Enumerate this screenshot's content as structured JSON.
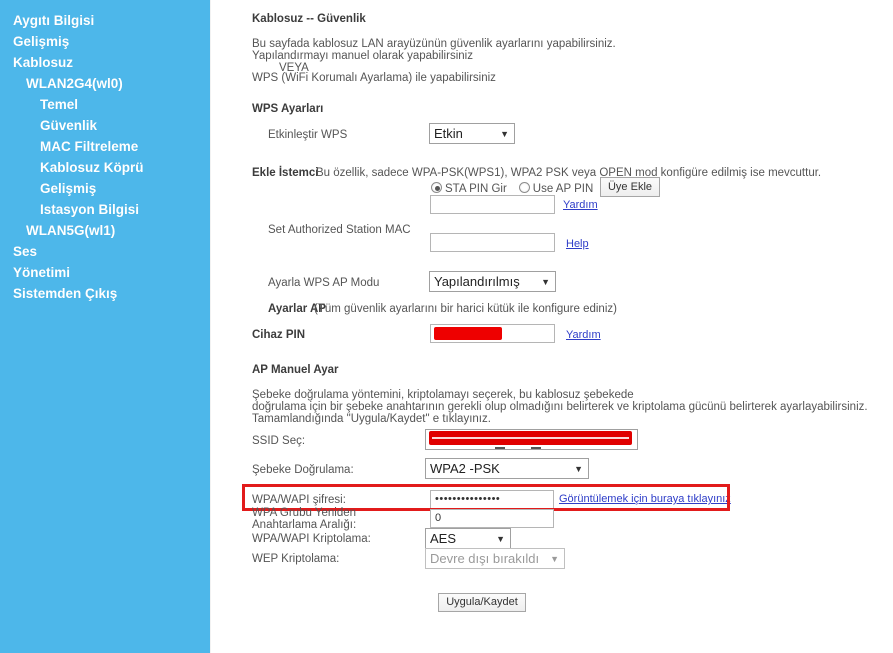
{
  "sidebar": {
    "bg_color": "#4db7ea",
    "items": [
      {
        "label": "Aygıtı Bilgisi",
        "level": 0
      },
      {
        "label": "Gelişmiş",
        "level": 0
      },
      {
        "label": "Kablosuz",
        "level": 0
      },
      {
        "label": "WLAN2G4(wl0)",
        "level": 1
      },
      {
        "label": "Temel",
        "level": 2
      },
      {
        "label": "Güvenlik",
        "level": 2
      },
      {
        "label": "MAC Filtreleme",
        "level": 2
      },
      {
        "label": "Kablosuz Köprü",
        "level": 2
      },
      {
        "label": "Gelişmiş",
        "level": 2
      },
      {
        "label": "Istasyon Bilgisi",
        "level": 2
      },
      {
        "label": "WLAN5G(wl1)",
        "level": 1
      },
      {
        "label": "Ses",
        "level": 0
      },
      {
        "label": "Yönetimi",
        "level": 0
      },
      {
        "label": "Sistemden Çıkış",
        "level": 0
      }
    ]
  },
  "page": {
    "title": "Kablosuz -- Güvenlik",
    "intro_line1": "Bu sayfada kablosuz LAN arayüzünün güvenlik ayarlarını yapabilirsiniz.",
    "intro_line2": "Yapılandırmayı manuel olarak yapabilirsiniz",
    "intro_or": "VEYA",
    "intro_line3": "WPS (WiFi Korumalı Ayarlama) ile yapabilirsiniz"
  },
  "wps": {
    "section_title": "WPS Ayarları",
    "enable_label": "Etkinleştir WPS",
    "enable_value": "Etkin",
    "add_client_label_bold": "Ekle İstemci",
    "add_client_note": "Bu özellik, sadece WPA-PSK(WPS1), WPA2 PSK veya OPEN mod konfigüre edilmiş ise mevcuttur.",
    "radio_sta_label": "STA PIN Gir",
    "radio_ap_label": "Use AP PIN",
    "radio_selected": "sta",
    "add_member_button": "Üye Ekle",
    "pin_input_value": "",
    "help_link_1": "Yardım",
    "authorized_mac_label": "Set Authorized Station MAC",
    "authorized_mac_value": "",
    "help_link_2": "Help",
    "ap_mode_label": "Ayarla WPS AP Modu",
    "ap_mode_value": "Yapılandırılmış",
    "ap_settings_note_bold": "Ayarlar AP",
    "ap_settings_note": "(Tüm güvenlik ayarlarını bir harici kütük ile konfigure ediniz)",
    "device_pin_label": "Cihaz PIN",
    "device_pin_value": "",
    "device_pin_redacted": true,
    "help_link_3": "Yardım"
  },
  "ap_manual": {
    "section_title": "AP Manuel Ayar",
    "desc_line1": "Şebeke doğrulama yöntemini, kriptolamayı seçerek, bu kablosuz şebekede",
    "desc_line2": "doğrulama için bir şebeke anahtarının gerekli olup olmadığını belirterek ve kriptolama gücünü belirterek ayarlayabilirsiniz.",
    "desc_line3": "Tamamlandığında \"Uygula/Kaydet\" e tıklayınız.",
    "ssid_label": "SSID Seç:",
    "ssid_value": "",
    "ssid_redacted": true,
    "network_auth_label": "Şebeke Doğrulama:",
    "network_auth_value": "WPA2 -PSK",
    "wpa_key_label": "WPA/WAPI şifresi:",
    "wpa_key_value": "•••••••••••••••",
    "wpa_key_reveal_link": "Görüntülemek için buraya tıklayınız",
    "wpa_key_highlighted": true,
    "rekey_label": "WPA Grubu Yeniden Anahtarlama Aralığı:",
    "rekey_value": "0",
    "wpa_crypto_label": "WPA/WAPI Kriptolama:",
    "wpa_crypto_value": "AES",
    "wep_crypto_label": "WEP Kriptolama:",
    "wep_crypto_value": "Devre dışı bırakıldı",
    "wep_crypto_disabled": true,
    "submit_button": "Uygula/Kaydet"
  },
  "colors": {
    "sidebar": "#4db7ea",
    "link": "#2e3dc8",
    "redaction": "#ee0000",
    "highlight": "#e21b1b"
  }
}
